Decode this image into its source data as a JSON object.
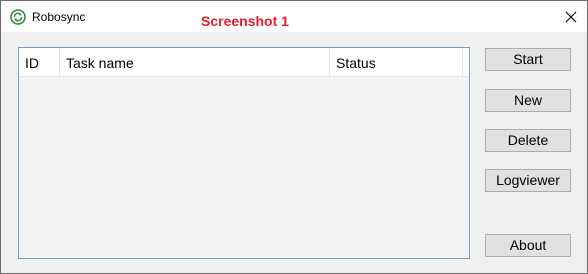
{
  "window": {
    "title": "Robosync",
    "annotation": "Screenshot 1"
  },
  "icons": {
    "app": "robosync-app-icon",
    "close": "close-icon"
  },
  "colors": {
    "annotation": "#e0202a",
    "list_border": "#7a99c8",
    "button_face": "#e1e1e1"
  },
  "task_list": {
    "columns": [
      "ID",
      "Task name",
      "Status"
    ],
    "rows": []
  },
  "buttons": {
    "start": "Start",
    "new": "New",
    "delete": "Delete",
    "logviewer": "Logviewer",
    "about": "About"
  }
}
